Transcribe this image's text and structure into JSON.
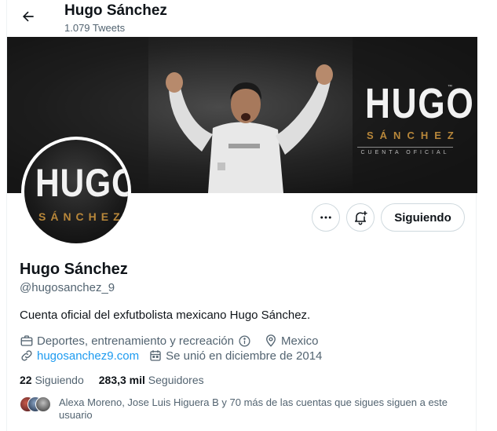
{
  "header": {
    "name": "Hugo Sánchez",
    "tweet_count": "1.079 Tweets"
  },
  "banner": {
    "logo_text": "HUGO",
    "logo_sub": "SÁNCHEZ",
    "logo_tag": "CUENTA OFICIAL",
    "tm": "™"
  },
  "avatar": {
    "logo_text": "HUGO",
    "logo_sub": "SÁNCHEZ"
  },
  "actions": {
    "follow_label": "Siguiendo"
  },
  "profile": {
    "name": "Hugo Sánchez",
    "handle": "@hugosanchez_9",
    "bio": "Cuenta oficial del exfutbolista mexicano Hugo Sánchez.",
    "category": "Deportes, entrenamiento y recreación",
    "location": "Mexico",
    "website": "hugosanchez9.com",
    "joined": "Se unió en diciembre de 2014"
  },
  "stats": {
    "following_count": "22",
    "following_label": "Siguiendo",
    "followers_count": "283,3 mil",
    "followers_label": "Seguidores"
  },
  "followed_by": {
    "text": "Alexa Moreno, Jose Luis Higuera B y 70 más de las cuentas que sigues siguen a este usuario"
  },
  "icons": {
    "back": "arrow-left-icon",
    "more": "more-dots-icon",
    "bell": "bell-plus-icon",
    "briefcase": "briefcase-icon",
    "info": "info-circle-icon",
    "location": "location-pin-icon",
    "link": "link-icon",
    "calendar": "calendar-icon"
  },
  "colors": {
    "accent": "#1d9bf0",
    "text_primary": "#0f1419",
    "text_secondary": "#536471",
    "border": "#cfd9de",
    "logo_gold": "#b8873a"
  }
}
